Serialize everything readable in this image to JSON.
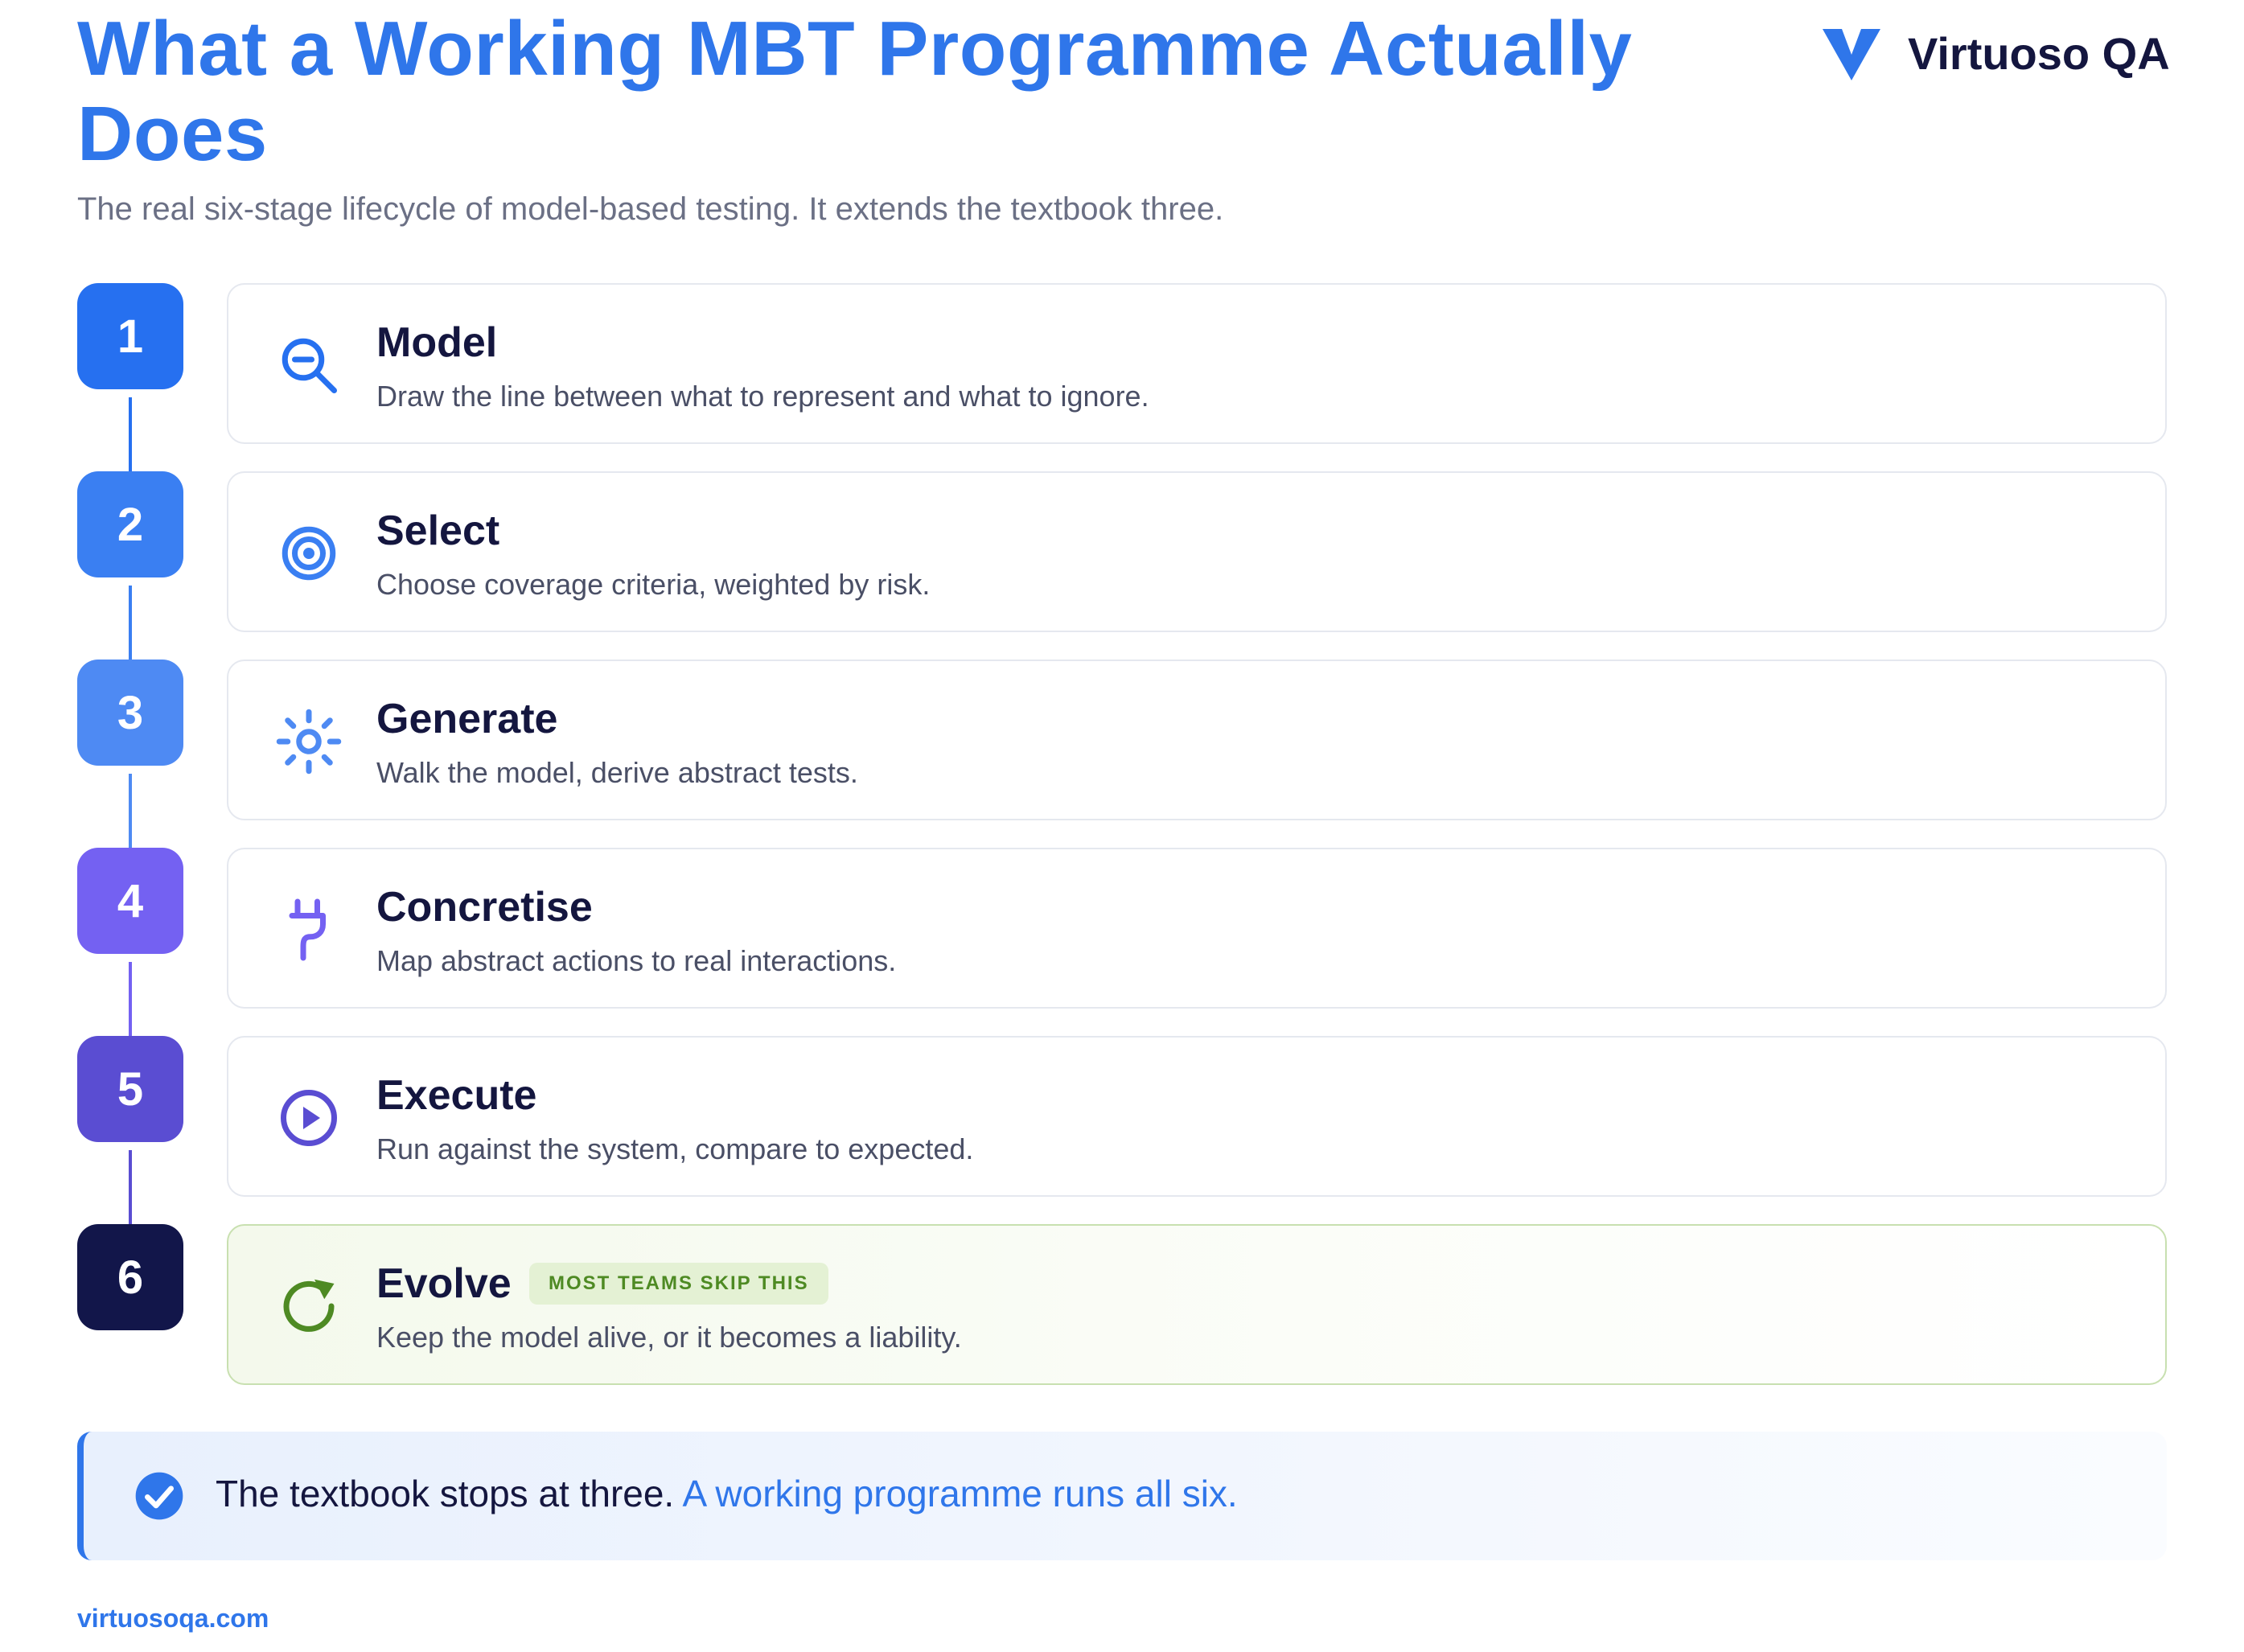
{
  "header": {
    "title": "What a Working MBT Programme Actually Does",
    "subtitle": "The real six-stage lifecycle of model-based testing. It extends the textbook three.",
    "brand": "Virtuoso QA"
  },
  "stages": [
    {
      "number": "1",
      "title": "Model",
      "description": "Draw the line between what to represent and what to ignore.",
      "icon": "magnifier-minus-icon",
      "color": "#2670f0"
    },
    {
      "number": "2",
      "title": "Select",
      "description": "Choose coverage criteria, weighted by risk.",
      "icon": "target-icon",
      "color": "#3a7ff2"
    },
    {
      "number": "3",
      "title": "Generate",
      "description": "Walk the model, derive abstract tests.",
      "icon": "sun-spark-icon",
      "color": "#4e8af3"
    },
    {
      "number": "4",
      "title": "Concretise",
      "description": "Map abstract actions to real interactions.",
      "icon": "plug-icon",
      "color": "#7461f2"
    },
    {
      "number": "5",
      "title": "Execute",
      "description": "Run against the system, compare to expected.",
      "icon": "play-circle-icon",
      "color": "#5a4dd2"
    },
    {
      "number": "6",
      "title": "Evolve",
      "description": "Keep the model alive, or it becomes a liability.",
      "icon": "refresh-icon",
      "color": "#12164a",
      "tag": "MOST TEAMS SKIP THIS",
      "tag_color": "#4e8a23"
    }
  ],
  "callout": {
    "lead": "The textbook stops at three.",
    "emphasis": "A working programme runs all six."
  },
  "footer": {
    "url": "virtuosoqa.com"
  }
}
